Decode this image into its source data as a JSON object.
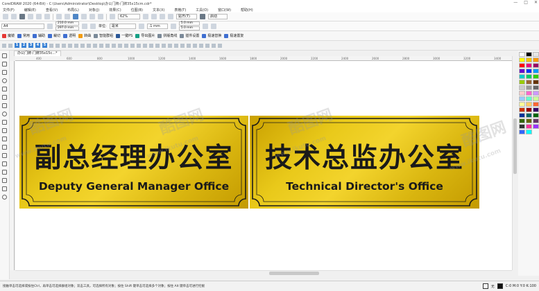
{
  "title_bar": {
    "title": "CorelDRAW 2020 (64-Bit) - C:\\Users\\Administrator\\Desktop\\办公门牌-门牌35x15cm.cdr*",
    "controls": [
      "—",
      "□",
      "✕"
    ]
  },
  "menu": [
    "文件(F)",
    "编辑(E)",
    "查看(V)",
    "布局(L)",
    "对象(J)",
    "效果(C)",
    "位图(B)",
    "文本(X)",
    "表格(T)",
    "工具(O)",
    "窗口(W)",
    "帮助(H)"
  ],
  "toolbar": {
    "zoom": "62%",
    "snap": "贴齐(T)",
    "launch": "启动"
  },
  "property_bar": {
    "page_size": "A4",
    "width": "210.0 mm",
    "height": "297.0 mm",
    "units_label": "单位:",
    "units": "毫米",
    "nudge": ".1 mm",
    "dup_x": "5.0 mm",
    "dup_y": "5.0 mm"
  },
  "plugin_bar": [
    "魔镜",
    "常用",
    "辅助",
    "裁切",
    "透明",
    "转曲",
    "智能群组",
    "一键PS",
    "导出图片",
    "拼版角线",
    "插件设置",
    "极速替换",
    "极速置复"
  ],
  "doc_tabs": [
    "1",
    "2",
    "3",
    "4",
    "5"
  ],
  "file_tab": "办公门牌-门牌35x15c...*",
  "ruler_ticks": [
    "400",
    "600",
    "800",
    "1000",
    "1200",
    "1400",
    "1600",
    "1800",
    "2000",
    "2200",
    "2400",
    "2600",
    "2800",
    "3000",
    "3200",
    "3400"
  ],
  "signs": [
    {
      "cn": "副总经理办公室",
      "en": "Deputy General Manager Office"
    },
    {
      "cn": "技术总监办公室",
      "en": "Technical Director's Office"
    }
  ],
  "watermark": {
    "brand": "酷图网",
    "url": "www.ikutu.com"
  },
  "status": {
    "message": "接触单击可选择或按住Ctrl，再单击可选择群组对象；双击工具，可选择所有对象；按住 Shift 键单击可选择多个对象；按住 Alt 键单击可进行挖掘",
    "fill_label": "无",
    "cmyk": "C:0 M:0 Y:0 K:100"
  },
  "palette_colors": [
    "#ffffff",
    "#000000",
    "#e6e6e6",
    "#ffff00",
    "#f2c300",
    "#ff9900",
    "#ff0000",
    "#e6007e",
    "#990066",
    "#6600cc",
    "#0033ff",
    "#0099ff",
    "#00cccc",
    "#00cc66",
    "#33cc00",
    "#99cc00",
    "#996633",
    "#663300",
    "#cccccc",
    "#999999",
    "#666666",
    "#ffcccc",
    "#ff66cc",
    "#cc99ff",
    "#99ccff",
    "#66ffcc",
    "#ccff99",
    "#ffff99",
    "#ffcc66",
    "#ff6633",
    "#cc3300",
    "#990000",
    "#330066",
    "#003399",
    "#006666",
    "#006600",
    "#336600",
    "#666600",
    "#663366",
    "#333333",
    "#ff3399",
    "#9933ff",
    "#3366ff",
    "#00ffff"
  ]
}
